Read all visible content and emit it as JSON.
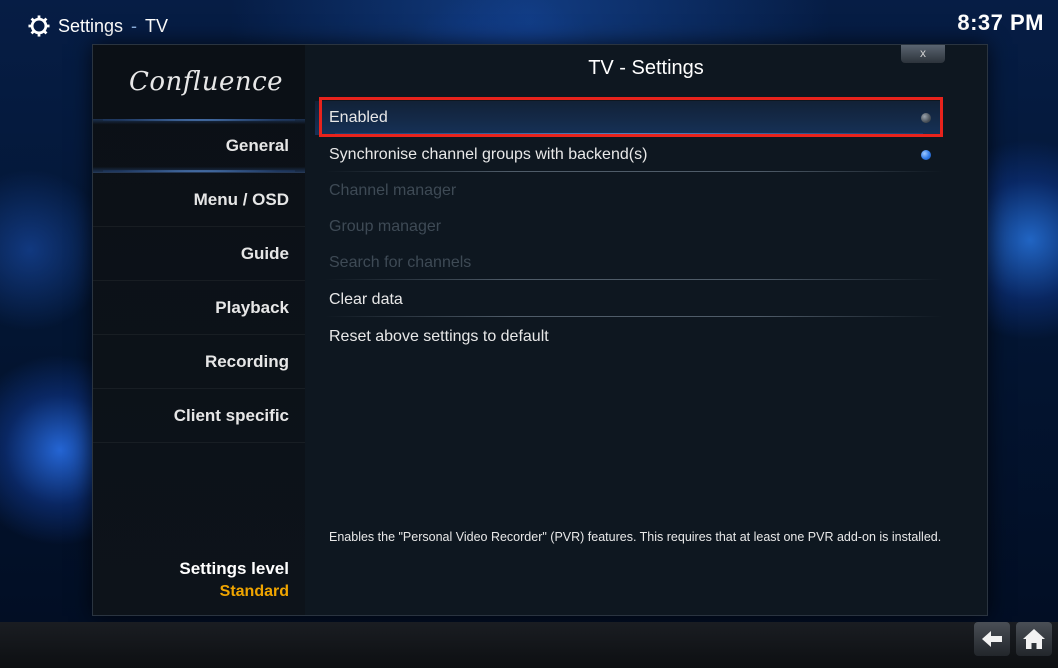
{
  "header": {
    "section": "Settings",
    "separator": "-",
    "subsection": "TV",
    "clock": "8:37 PM"
  },
  "sidebar": {
    "logo": "Confluence",
    "items": [
      {
        "label": "General"
      },
      {
        "label": "Menu / OSD"
      },
      {
        "label": "Guide"
      },
      {
        "label": "Playback"
      },
      {
        "label": "Recording"
      },
      {
        "label": "Client specific"
      }
    ],
    "settings_level_label": "Settings level",
    "settings_level_value": "Standard"
  },
  "dialog": {
    "title": "TV - Settings",
    "close_label": "x"
  },
  "settings": [
    {
      "label": "Enabled",
      "state": "off",
      "enabled": true
    },
    {
      "label": "Synchronise channel groups with backend(s)",
      "state": "on",
      "enabled": true
    },
    {
      "label": "Channel manager",
      "enabled": false
    },
    {
      "label": "Group manager",
      "enabled": false
    },
    {
      "label": "Search for channels",
      "enabled": false
    },
    {
      "label": "Clear data",
      "enabled": true
    },
    {
      "label": "Reset above settings to default",
      "enabled": true
    }
  ],
  "description": "Enables the \"Personal Video Recorder\" (PVR) features. This requires that at least one PVR add-on is installed.",
  "footer": {
    "back_icon": "back-arrow-icon",
    "home_icon": "home-icon"
  },
  "colors": {
    "accent": "#2f7ae6",
    "level_value": "#f0a500",
    "highlight": "#e8231c"
  }
}
